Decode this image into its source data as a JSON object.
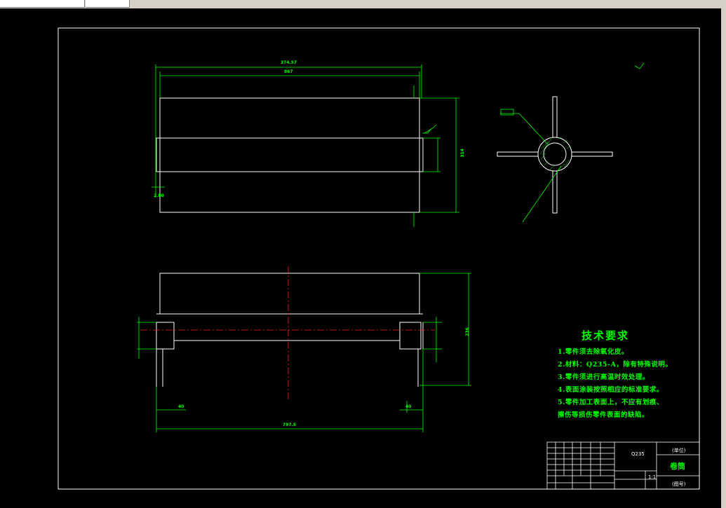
{
  "drawing": {
    "tech_req_title": "技术要求",
    "tech_req": [
      "1.零件须去除氧化皮。",
      "2.材料：Q235-A，除有特殊说明。",
      "3.零件须进行高温时效处理。",
      "4.表面涂装按照相应的标准要求。",
      "5.零件加工表面上，不应有划痕、",
      "擦伤等损伤零件表面的缺陷。"
    ],
    "title_block": {
      "part_name": "卷筒",
      "label_top": "(单位)",
      "label_bottom": "(图号)",
      "label_mid": "Q235",
      "scale": "1:1"
    },
    "dims": {
      "top_overall": "374.57",
      "top_inner": "867",
      "dim_right": "314",
      "dim_bottom_left": "2.80",
      "dim_bottom_overall": "797.5",
      "dim_left_small": "40",
      "dim_right_small": "40",
      "dim_height": "236"
    },
    "colors": {
      "outline": "#ffffff",
      "dimension": "#00ff00",
      "centerline": "#ff2020",
      "background": "#000000"
    }
  }
}
